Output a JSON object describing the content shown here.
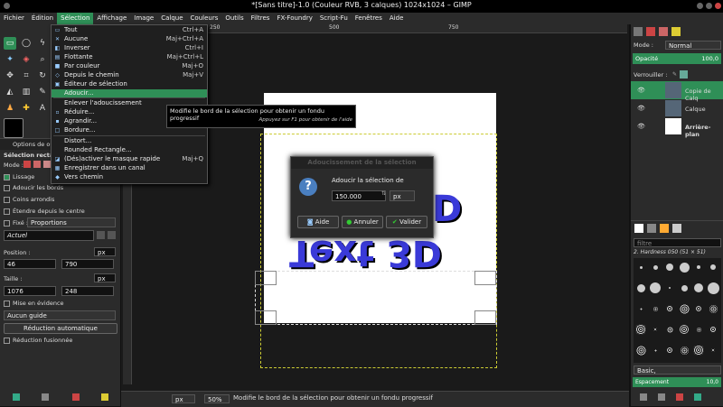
{
  "window": {
    "title": "*[Sans titre]-1.0 (Couleur RVB, 3 calques) 1024x1024 – GIMP"
  },
  "menubar": [
    "Fichier",
    "Édition",
    "Sélection",
    "Affichage",
    "Image",
    "Calque",
    "Couleurs",
    "Outils",
    "Filtres",
    "FX-Foundry",
    "Script-Fu",
    "Fenêtres",
    "Aide"
  ],
  "selection_menu": [
    {
      "label": "Tout",
      "accel": "Ctrl+A",
      "icon": "▭"
    },
    {
      "label": "Aucune",
      "accel": "Maj+Ctrl+A",
      "icon": "✕"
    },
    {
      "label": "Inverser",
      "accel": "Ctrl+I",
      "icon": "◧"
    },
    {
      "label": "Flottante",
      "accel": "Maj+Ctrl+L",
      "icon": "▤"
    },
    {
      "label": "Par couleur",
      "accel": "Maj+O",
      "icon": "■"
    },
    {
      "label": "Depuis le chemin",
      "accel": "Maj+V",
      "icon": "◇"
    },
    {
      "label": "Éditeur de sélection",
      "accel": "",
      "icon": "▣"
    },
    {
      "label": "Adoucir...",
      "accel": "",
      "icon": ""
    },
    {
      "label": "Enlever l'adoucissement",
      "accel": "",
      "icon": ""
    },
    {
      "label": "Réduire...",
      "accel": "",
      "icon": "▫"
    },
    {
      "label": "Agrandir...",
      "accel": "",
      "icon": "▪"
    },
    {
      "label": "Bordure...",
      "accel": "",
      "icon": "□"
    },
    {
      "label": "Distort...",
      "accel": "",
      "icon": ""
    },
    {
      "label": "Rounded Rectangle...",
      "accel": "",
      "icon": ""
    },
    {
      "label": "(Dés)activer le masque rapide",
      "accel": "Maj+Q",
      "icon": "◪"
    },
    {
      "label": "Enregistrer dans un canal",
      "accel": "",
      "icon": "▦"
    },
    {
      "label": "Vers chemin",
      "accel": "",
      "icon": "◆"
    }
  ],
  "tooltip": {
    "text": "Modifie le bord de la sélection pour obtenir un fondu progressif",
    "hint": "Appuyez sur F1 pour obtenir de l'aide"
  },
  "dialog": {
    "title": "Adoucissement de la sélection",
    "label": "Adoucir la sélection de",
    "value": "150.000",
    "unit": "px",
    "help": "Aide",
    "cancel": "Annuler",
    "ok": "Valider"
  },
  "tool_options": {
    "tab": "Options de ou",
    "title": "Sélection rectang",
    "mode_label": "Mode :",
    "smoothing": "Lissage",
    "feather": "Adoucir les bords",
    "rounded": "Coins arrondis",
    "from_center": "Étendre depuis le centre",
    "fixed": "Fixé :",
    "fixed_value": "Proportions",
    "current": "Actuel",
    "position_label": "Position :",
    "pos_x": "46",
    "pos_y": "790",
    "pos_unit": "px",
    "size_label": "Taille :",
    "size_w": "1076",
    "size_h": "248",
    "size_unit": "px",
    "highlight": "Mise en évidence",
    "guides": "Aucun guide",
    "auto_shrink": "Réduction automatique",
    "merged": "Réduction fusionnée"
  },
  "canvas": {
    "text_main": "Text 3D",
    "text_partial": "D",
    "ruler_marks": [
      "250",
      "500",
      "750"
    ]
  },
  "layers": {
    "mode_label": "Mode :",
    "mode_value": "Normal",
    "opacity_label": "Opacité",
    "opacity_value": "100,0",
    "lock_label": "Verrouiller :",
    "items": [
      {
        "name": "Copie de Calq"
      },
      {
        "name": "Calque"
      },
      {
        "name": "Arrière-plan"
      }
    ]
  },
  "brushes": {
    "filter_placeholder": "filtre",
    "current": "2. Hardness 050 (51 × 51)",
    "category": "Basic,",
    "spacing_label": "Espacement",
    "spacing_value": "10,0"
  },
  "status": {
    "unit": "px",
    "zoom": "50%",
    "message": "Modifie le bord de la sélection pour obtenir un fondu progressif"
  },
  "colors": {
    "accent": "#2f8f57",
    "bg": "#2b2b2b",
    "text_blue": "#3a3ad8"
  }
}
